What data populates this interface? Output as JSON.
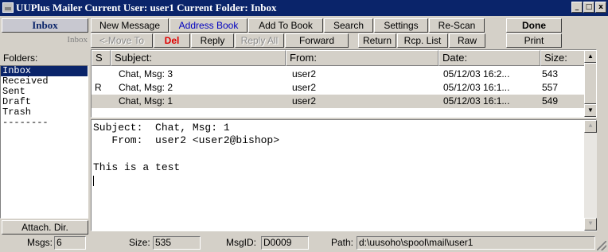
{
  "window": {
    "title": "UUPlus Mailer   Current User: user1   Current Folder: Inbox",
    "minimize_label": "_",
    "maximize_label": "□",
    "close_label": "x"
  },
  "left_panel": {
    "inbox_button": "Inbox",
    "current_folder_label": "Inbox",
    "folders_label": "Folders:",
    "folders": [
      "Inbox",
      "Received",
      "Sent",
      "Draft",
      "Trash",
      "--------"
    ],
    "selected_folder": "Inbox",
    "attach_dir_button": "Attach. Dir."
  },
  "toolbar": {
    "row1": [
      "New Message",
      "Address Book",
      "Add To Book",
      "Search",
      "Settings",
      "Re-Scan",
      "Done"
    ],
    "row2": [
      "<-Move To",
      "Del",
      "Reply",
      "Reply All",
      "Forward",
      "Return",
      "Rcp. List",
      "Raw",
      "Print"
    ]
  },
  "message_list": {
    "columns": [
      "S",
      "Subject:",
      "From:",
      "Date:",
      "Size:"
    ],
    "rows": [
      {
        "status": "",
        "subject": "Chat, Msg: 3",
        "from": "user2",
        "date": "05/12/03 16:2...",
        "size": "543"
      },
      {
        "status": "R",
        "subject": "Chat, Msg: 2",
        "from": "user2",
        "date": "05/12/03 16:1...",
        "size": "557"
      },
      {
        "status": "",
        "subject": "Chat, Msg: 1",
        "from": "user2",
        "date": "05/12/03 16:1...",
        "size": "549"
      }
    ],
    "selected_index": 2
  },
  "message_body": {
    "lines": [
      "Subject:  Chat, Msg: 1",
      "   From:  user2 <user2@bishop>",
      "",
      "This is a test"
    ]
  },
  "status_bar": {
    "msgs_label": "Msgs:",
    "msgs_value": "6",
    "size_label": "Size:",
    "size_value": "535",
    "msgid_label": "MsgID:",
    "msgid_value": "D0009",
    "path_label": "Path:",
    "path_value": "d:\\uusoho\\spool\\mail\\user1"
  },
  "colors": {
    "title_bar": "#0a246a",
    "face": "#d4d0c8",
    "selection": "#0a246a",
    "accent_blue_text": "#0000c0",
    "delete_red": "#e00000"
  }
}
